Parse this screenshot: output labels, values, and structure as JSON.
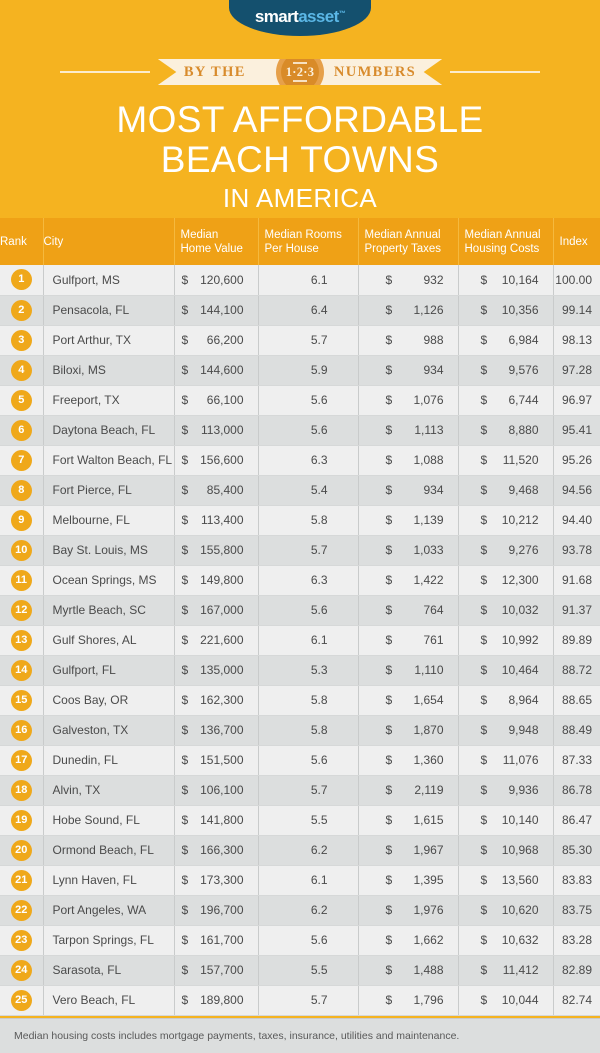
{
  "brand": {
    "logo_smart": "smart",
    "logo_asset": "asset",
    "logo_tm": "™",
    "logo_bg": "#14506E",
    "accent": "#F5B320"
  },
  "ribbon": {
    "left_label": "BY THE",
    "right_label": "NUMBERS",
    "badge_number": "1·2·3"
  },
  "title": {
    "line1": "MOST AFFORDABLE",
    "line2": "BEACH TOWNS",
    "line3": "IN AMERICA"
  },
  "table": {
    "columns": [
      "Rank",
      "City",
      "Median\nHome Value",
      "Median Rooms\nPer House",
      "Median Annual\nProperty Taxes",
      "Median Annual\nHousing Costs",
      "Index"
    ],
    "columns_flat": {
      "rank": "Rank",
      "city": "City",
      "home_value_1": "Median",
      "home_value_2": "Home Value",
      "rooms_1": "Median Rooms",
      "rooms_2": "Per House",
      "taxes_1": "Median Annual",
      "taxes_2": "Property Taxes",
      "housing_1": "Median Annual",
      "housing_2": "Housing Costs",
      "index": "Index"
    },
    "rows": [
      {
        "rank": "1",
        "city": "Gulfport, MS",
        "home_value": "120,600",
        "rooms": "6.1",
        "taxes": "932",
        "housing": "10,164",
        "index": "100.00"
      },
      {
        "rank": "2",
        "city": "Pensacola, FL",
        "home_value": "144,100",
        "rooms": "6.4",
        "taxes": "1,126",
        "housing": "10,356",
        "index": "99.14"
      },
      {
        "rank": "3",
        "city": "Port Arthur, TX",
        "home_value": "66,200",
        "rooms": "5.7",
        "taxes": "988",
        "housing": "6,984",
        "index": "98.13"
      },
      {
        "rank": "4",
        "city": "Biloxi, MS",
        "home_value": "144,600",
        "rooms": "5.9",
        "taxes": "934",
        "housing": "9,576",
        "index": "97.28"
      },
      {
        "rank": "5",
        "city": "Freeport, TX",
        "home_value": "66,100",
        "rooms": "5.6",
        "taxes": "1,076",
        "housing": "6,744",
        "index": "96.97"
      },
      {
        "rank": "6",
        "city": "Daytona Beach, FL",
        "home_value": "113,000",
        "rooms": "5.6",
        "taxes": "1,113",
        "housing": "8,880",
        "index": "95.41"
      },
      {
        "rank": "7",
        "city": "Fort Walton Beach, FL",
        "home_value": "156,600",
        "rooms": "6.3",
        "taxes": "1,088",
        "housing": "11,520",
        "index": "95.26"
      },
      {
        "rank": "8",
        "city": "Fort Pierce, FL",
        "home_value": "85,400",
        "rooms": "5.4",
        "taxes": "934",
        "housing": "9,468",
        "index": "94.56"
      },
      {
        "rank": "9",
        "city": "Melbourne, FL",
        "home_value": "113,400",
        "rooms": "5.8",
        "taxes": "1,139",
        "housing": "10,212",
        "index": "94.40"
      },
      {
        "rank": "10",
        "city": "Bay St. Louis, MS",
        "home_value": "155,800",
        "rooms": "5.7",
        "taxes": "1,033",
        "housing": "9,276",
        "index": "93.78"
      },
      {
        "rank": "11",
        "city": "Ocean Springs, MS",
        "home_value": "149,800",
        "rooms": "6.3",
        "taxes": "1,422",
        "housing": "12,300",
        "index": "91.68"
      },
      {
        "rank": "12",
        "city": "Myrtle Beach, SC",
        "home_value": "167,000",
        "rooms": "5.6",
        "taxes": "764",
        "housing": "10,032",
        "index": "91.37"
      },
      {
        "rank": "13",
        "city": "Gulf Shores, AL",
        "home_value": "221,600",
        "rooms": "6.1",
        "taxes": "761",
        "housing": "10,992",
        "index": "89.89"
      },
      {
        "rank": "14",
        "city": "Gulfport, FL",
        "home_value": "135,000",
        "rooms": "5.3",
        "taxes": "1,110",
        "housing": "10,464",
        "index": "88.72"
      },
      {
        "rank": "15",
        "city": "Coos Bay, OR",
        "home_value": "162,300",
        "rooms": "5.8",
        "taxes": "1,654",
        "housing": "8,964",
        "index": "88.65"
      },
      {
        "rank": "16",
        "city": "Galveston, TX",
        "home_value": "136,700",
        "rooms": "5.8",
        "taxes": "1,870",
        "housing": "9,948",
        "index": "88.49"
      },
      {
        "rank": "17",
        "city": "Dunedin, FL",
        "home_value": "151,500",
        "rooms": "5.6",
        "taxes": "1,360",
        "housing": "11,076",
        "index": "87.33"
      },
      {
        "rank": "18",
        "city": "Alvin, TX",
        "home_value": "106,100",
        "rooms": "5.7",
        "taxes": "2,119",
        "housing": "9,936",
        "index": "86.78"
      },
      {
        "rank": "19",
        "city": "Hobe Sound, FL",
        "home_value": "141,800",
        "rooms": "5.5",
        "taxes": "1,615",
        "housing": "10,140",
        "index": "86.47"
      },
      {
        "rank": "20",
        "city": "Ormond Beach, FL",
        "home_value": "166,300",
        "rooms": "6.2",
        "taxes": "1,967",
        "housing": "10,968",
        "index": "85.30"
      },
      {
        "rank": "21",
        "city": "Lynn Haven, FL",
        "home_value": "173,300",
        "rooms": "6.1",
        "taxes": "1,395",
        "housing": "13,560",
        "index": "83.83"
      },
      {
        "rank": "22",
        "city": "Port Angeles, WA",
        "home_value": "196,700",
        "rooms": "6.2",
        "taxes": "1,976",
        "housing": "10,620",
        "index": "83.75"
      },
      {
        "rank": "23",
        "city": "Tarpon Springs, FL",
        "home_value": "161,700",
        "rooms": "5.6",
        "taxes": "1,662",
        "housing": "10,632",
        "index": "83.28"
      },
      {
        "rank": "24",
        "city": "Sarasota, FL",
        "home_value": "157,700",
        "rooms": "5.5",
        "taxes": "1,488",
        "housing": "11,412",
        "index": "82.89"
      },
      {
        "rank": "25",
        "city": "Vero Beach, FL",
        "home_value": "189,800",
        "rooms": "5.7",
        "taxes": "1,796",
        "housing": "10,044",
        "index": "82.74"
      }
    ],
    "currency_symbol": "$"
  },
  "footnote": {
    "text": "Median housing costs includes mortgage payments, taxes, insurance, utilities and maintenance."
  }
}
